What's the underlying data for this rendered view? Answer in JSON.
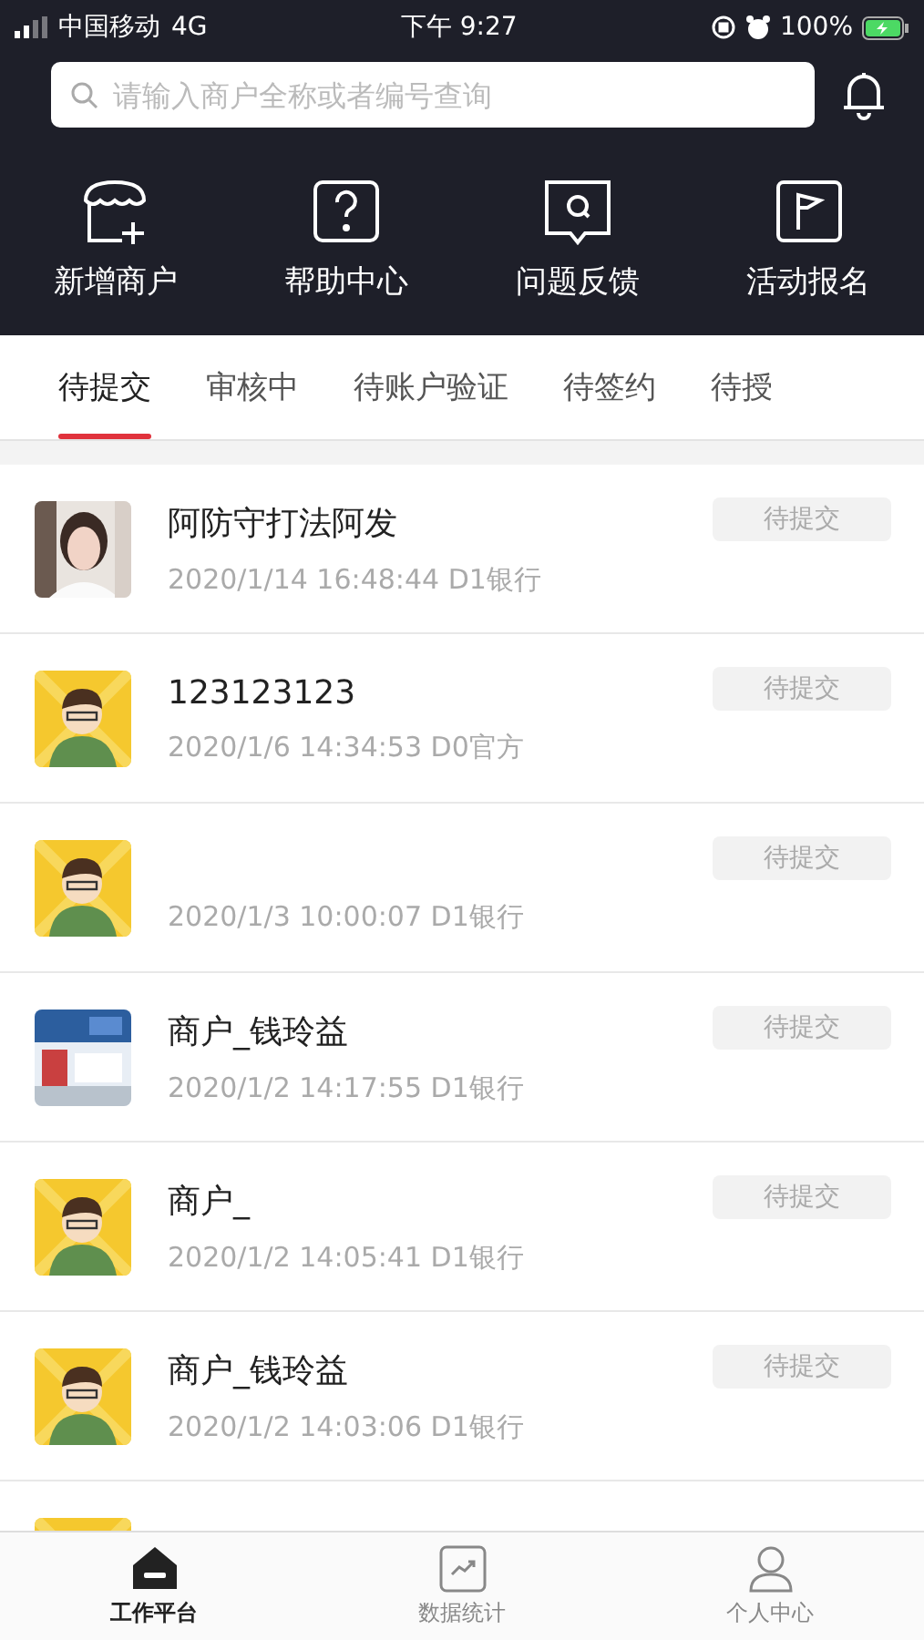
{
  "status_bar": {
    "carrier": "中国移动",
    "network": "4G",
    "time": "下午 9:27",
    "battery": "100%"
  },
  "search": {
    "placeholder": "请输入商户全称或者编号查询"
  },
  "shortcuts": [
    {
      "kind": "store",
      "label": "新增商户"
    },
    {
      "kind": "help",
      "label": "帮助中心"
    },
    {
      "kind": "feedback",
      "label": "问题反馈"
    },
    {
      "kind": "flag",
      "label": "活动报名"
    }
  ],
  "tabs": [
    {
      "label": "待提交",
      "selected": true
    },
    {
      "label": "审核中",
      "selected": false
    },
    {
      "label": "待账户验证",
      "selected": false
    },
    {
      "label": "待签约",
      "selected": false
    },
    {
      "label": "待授",
      "selected": false
    }
  ],
  "merchants": [
    {
      "name": "阿防守打法阿发",
      "time": "2020/1/14 16:48:44",
      "channel": "D1银行",
      "status": "待提交"
    },
    {
      "kind": "cartoon",
      "name": "123123123",
      "time": "2020/1/6 14:34:53",
      "channel": "D0官方",
      "status": "待提交"
    },
    {
      "kind": "cartoon",
      "time": "2020/1/3 10:00:07",
      "channel": "D1银行",
      "status": "待提交"
    },
    {
      "kind": "shop",
      "name": "商户_钱玲益",
      "time": "2020/1/2 14:17:55",
      "channel": "D1银行",
      "status": "待提交"
    },
    {
      "kind": "cartoon",
      "name": "商户_",
      "time": "2020/1/2 14:05:41",
      "channel": "D1银行",
      "status": "待提交"
    },
    {
      "kind": "cartoon",
      "name": "商户_钱玲益",
      "time": "2020/1/2 14:03:06",
      "channel": "D1银行",
      "status": "待提交"
    },
    {
      "kind": "cartoon"
    }
  ],
  "bottom_nav": [
    {
      "kind": "home",
      "label": "工作平台",
      "selected": true
    },
    {
      "kind": "chart",
      "label": "数据统计",
      "selected": false
    },
    {
      "kind": "person",
      "label": "个人中心",
      "selected": false
    }
  ]
}
